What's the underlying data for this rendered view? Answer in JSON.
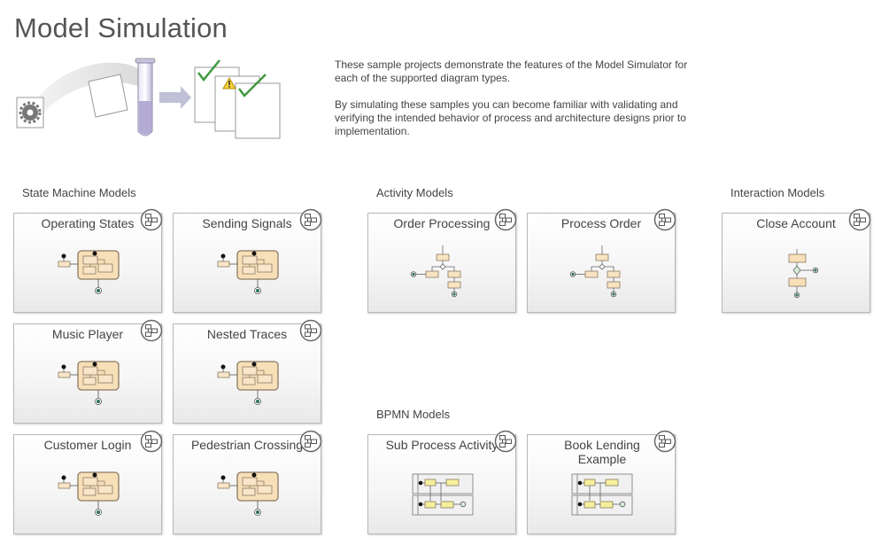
{
  "page": {
    "title": "Model Simulation"
  },
  "intro": {
    "paragraph1": "These sample projects demonstrate the features of the Model Simulator for each of the supported diagram types.",
    "paragraph2": "By simulating these samples you can become familiar with validating and verifying the intended behavior of process and architecture designs prior to implementation."
  },
  "sections": {
    "state_machine": {
      "title": "State Machine Models",
      "items": [
        "Operating States",
        "Sending Signals",
        "Music Player",
        "Nested Traces",
        "Customer Login",
        "Pedestrian Crossing"
      ]
    },
    "activity": {
      "title": "Activity Models",
      "items": [
        "Order Processing",
        "Process Order"
      ]
    },
    "interaction": {
      "title": "Interaction Models",
      "items": [
        "Close Account"
      ]
    },
    "bpmn": {
      "title": "BPMN Models",
      "items": [
        "Sub Process Activity",
        "Book Lending Example"
      ]
    }
  },
  "icons": {
    "badge": "open-model-icon",
    "hero": [
      "gear-icon",
      "paper-sheet-icon",
      "test-tube-icon",
      "arrow-right-icon",
      "checkmark-icon",
      "warning-icon"
    ]
  },
  "colors": {
    "state_fill": "#f7dfb8",
    "state_stroke": "#8c7a63",
    "activity_fill": "#f8e3c2",
    "bpmn_fill": "#f5f09c",
    "interaction_fill": "#f7dfb8"
  }
}
